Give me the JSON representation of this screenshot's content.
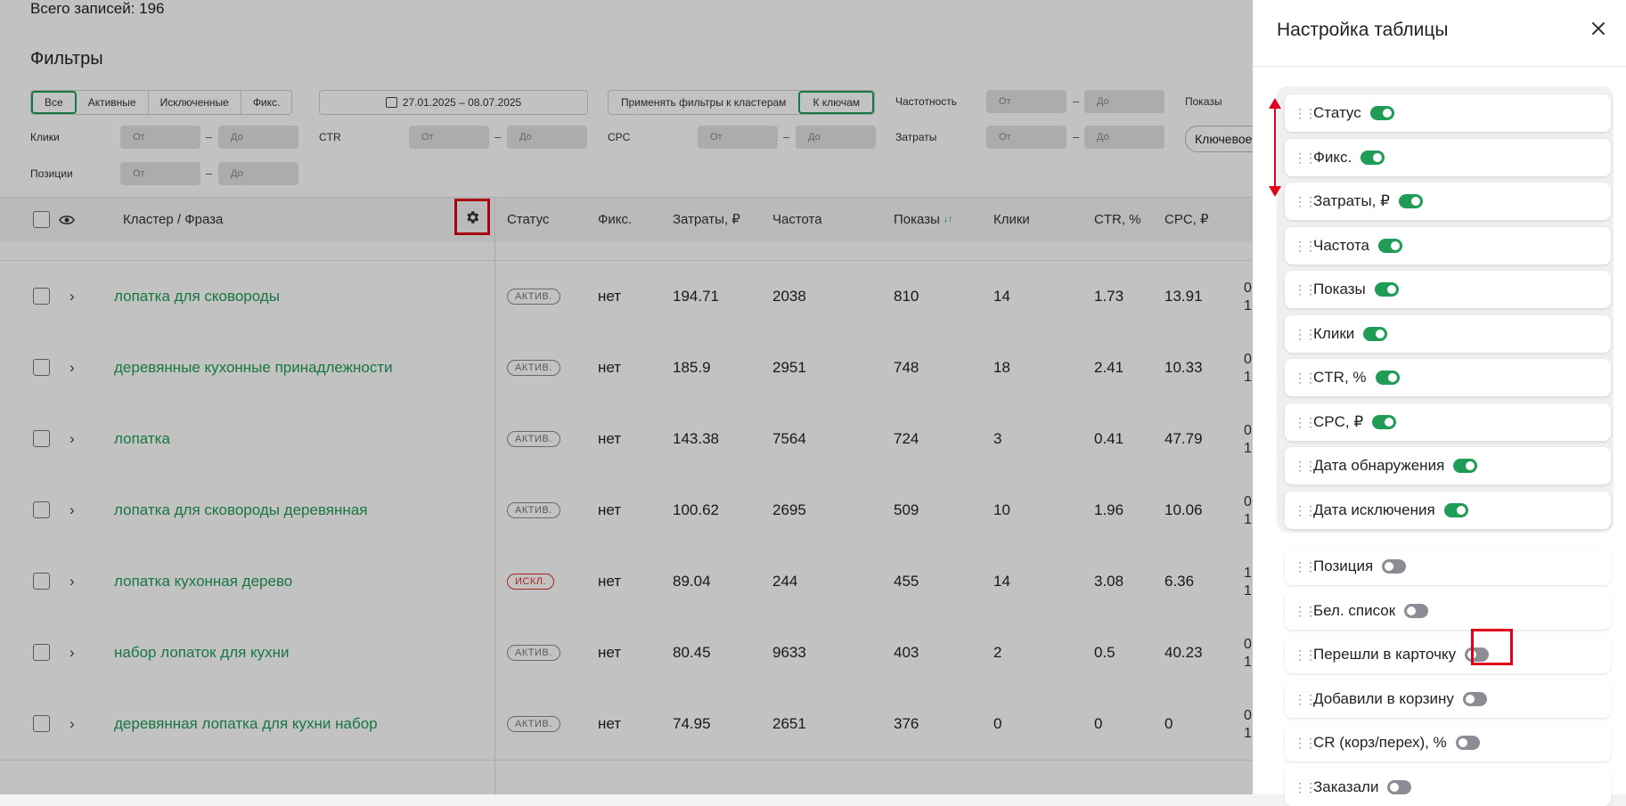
{
  "total_records": "Всего записей: 196",
  "filters": {
    "title": "Фильтры",
    "status_tabs": [
      "Все",
      "Активные",
      "Исключенные",
      "Фикс."
    ],
    "date_range": "27.01.2025 – 08.07.2025",
    "apply_group": [
      "Применять фильтры к кластерам",
      "К ключам"
    ],
    "range_labels": {
      "frequency": "Частотность",
      "impressions": "Показы",
      "clicks": "Клики",
      "ctr": "CTR",
      "cpc": "CPC",
      "costs": "Затраты",
      "positions": "Позиции"
    },
    "from_placeholder": "От",
    "to_placeholder": "До",
    "dash": "–",
    "keyword_pill": "Ключевое"
  },
  "table": {
    "headers": {
      "cluster": "Кластер / Фраза",
      "status": "Статус",
      "fixed": "Фикс.",
      "costs": "Затраты, ₽",
      "frequency": "Частота",
      "impressions": "Показы",
      "clicks": "Клики",
      "ctr": "CTR, %",
      "cpc": "CPC, ₽"
    },
    "rows": [
      {
        "phrase": "лопатка для сковороды",
        "status": "АКТИВ.",
        "fixed": "нет",
        "costs": "194.71",
        "frequency": "2038",
        "impressions": "810",
        "clicks": "14",
        "ctr": "1.73",
        "cpc": "13.91",
        "extra1": "0",
        "extra2": "1"
      },
      {
        "phrase": "деревянные кухонные принадлежности",
        "status": "АКТИВ.",
        "fixed": "нет",
        "costs": "185.9",
        "frequency": "2951",
        "impressions": "748",
        "clicks": "18",
        "ctr": "2.41",
        "cpc": "10.33",
        "extra1": "0",
        "extra2": "1"
      },
      {
        "phrase": "лопатка",
        "status": "АКТИВ.",
        "fixed": "нет",
        "costs": "143.38",
        "frequency": "7564",
        "impressions": "724",
        "clicks": "3",
        "ctr": "0.41",
        "cpc": "47.79",
        "extra1": "0",
        "extra2": "1"
      },
      {
        "phrase": "лопатка для сковороды деревянная",
        "status": "АКТИВ.",
        "fixed": "нет",
        "costs": "100.62",
        "frequency": "2695",
        "impressions": "509",
        "clicks": "10",
        "ctr": "1.96",
        "cpc": "10.06",
        "extra1": "0",
        "extra2": "1"
      },
      {
        "phrase": "лопатка кухонная дерево",
        "status": "ИСКЛ.",
        "fixed": "нет",
        "costs": "89.04",
        "frequency": "244",
        "impressions": "455",
        "clicks": "14",
        "ctr": "3.08",
        "cpc": "6.36",
        "extra1": "1",
        "extra2": "1"
      },
      {
        "phrase": "набор лопаток для кухни",
        "status": "АКТИВ.",
        "fixed": "нет",
        "costs": "80.45",
        "frequency": "9633",
        "impressions": "403",
        "clicks": "2",
        "ctr": "0.5",
        "cpc": "40.23",
        "extra1": "0",
        "extra2": "1"
      },
      {
        "phrase": "деревянная лопатка для кухни набор",
        "status": "АКТИВ.",
        "fixed": "нет",
        "costs": "74.95",
        "frequency": "2651",
        "impressions": "376",
        "clicks": "0",
        "ctr": "0",
        "cpc": "0",
        "extra1": "0",
        "extra2": "1"
      }
    ]
  },
  "panel": {
    "title": "Настройка таблицы",
    "items": [
      {
        "label": "Статус",
        "on": true
      },
      {
        "label": "Фикс.",
        "on": true
      },
      {
        "label": "Затраты, ₽",
        "on": true
      },
      {
        "label": "Частота",
        "on": true
      },
      {
        "label": "Показы",
        "on": true
      },
      {
        "label": "Клики",
        "on": true
      },
      {
        "label": "CTR, %",
        "on": true
      },
      {
        "label": "CPC, ₽",
        "on": true
      },
      {
        "label": "Дата обнаружения",
        "on": true
      },
      {
        "label": "Дата исключения",
        "on": true
      },
      {
        "label": "Позиция",
        "on": false
      },
      {
        "label": "Бел. список",
        "on": false
      },
      {
        "label": "Перешли в карточку",
        "on": false
      },
      {
        "label": "Добавили в корзину",
        "on": false
      },
      {
        "label": "CR (корз/перех), %",
        "on": false
      },
      {
        "label": "Заказали",
        "on": false
      }
    ]
  },
  "colors": {
    "accent": "#1f9d57",
    "highlight": "#e0001b",
    "excluded": "#e03030",
    "toggle_off": "#8c8c94"
  }
}
